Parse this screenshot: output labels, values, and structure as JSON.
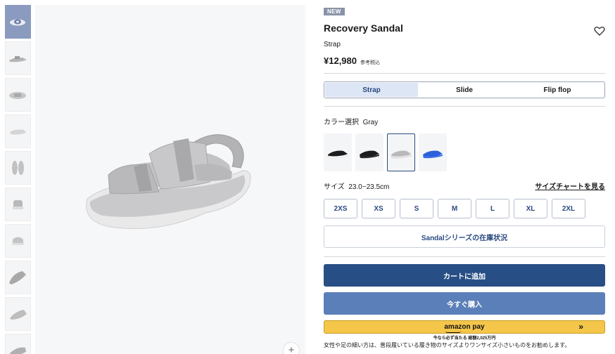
{
  "product": {
    "badge": "NEW",
    "title": "Recovery Sandal",
    "subtitle": "Strap",
    "price": "¥12,980",
    "price_note": "参考税込"
  },
  "tabs": [
    {
      "label": "Strap",
      "active": true
    },
    {
      "label": "Slide",
      "active": false
    },
    {
      "label": "Flip flop",
      "active": false
    }
  ],
  "color": {
    "label": "カラー選択",
    "value": "Gray",
    "swatches": [
      {
        "name": "black-white",
        "selected": false,
        "body": "#1d1d1d",
        "sole": "#ffffff"
      },
      {
        "name": "black",
        "selected": false,
        "body": "#1d1d1d",
        "sole": "#2a2a2a"
      },
      {
        "name": "gray",
        "selected": true,
        "body": "#b9b9bb",
        "sole": "#e6e6e6"
      },
      {
        "name": "blue",
        "selected": false,
        "body": "#2b60d9",
        "sole": "#3a6fe8"
      }
    ]
  },
  "size": {
    "label": "サイズ",
    "value": "23.0~23.5cm",
    "chart_link": "サイズチャートを見る",
    "options": [
      "2XS",
      "XS",
      "S",
      "M",
      "L",
      "XL",
      "2XL"
    ]
  },
  "stock_button": "Sandalシリーズの在庫状況",
  "cart_button": "カートに追加",
  "buy_button": "今すぐ購入",
  "amazon": {
    "logo": "amazon pay",
    "arrow": "»",
    "note": "今なら必ず当たる 総額2,025万円"
  },
  "fit_note": "女性や足の細い方は、普段履いている履き物のサイズよりワンサイズ小さいものをお勧めします。",
  "gallery": {
    "zoom_label": "+",
    "thumbnail_count": 10,
    "active_index": 0
  },
  "colors": {
    "accent": "#284f85",
    "buy": "#5b7fb8",
    "amazon": "#f4c64a",
    "badge": "#8a93a8"
  }
}
